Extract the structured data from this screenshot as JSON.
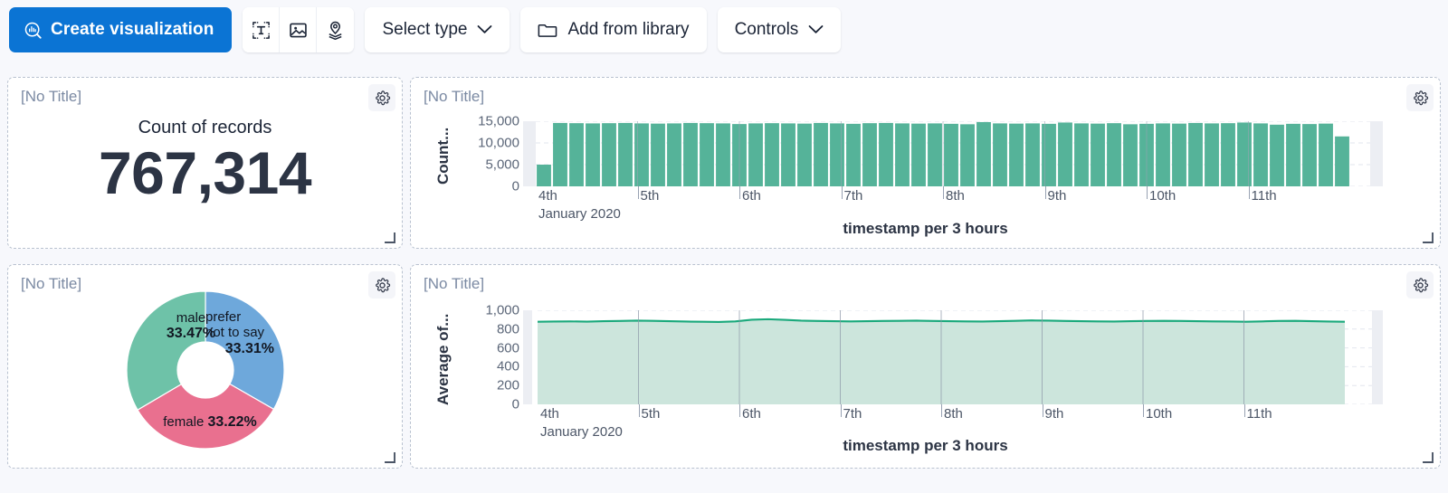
{
  "toolbar": {
    "create_button": "Create visualization",
    "create_icon": "lens-visualization-icon",
    "icon_buttons": [
      {
        "name": "text-icon",
        "label": "Text"
      },
      {
        "name": "image-icon",
        "label": "Image"
      },
      {
        "name": "map-layers-icon",
        "label": "Map"
      }
    ],
    "select_type": "Select type",
    "add_from_library": "Add from library",
    "add_from_library_icon": "folder-icon",
    "controls": "Controls",
    "chevron_icon": "chevron-down-icon",
    "primary_color": "#0b74d4"
  },
  "panels": [
    {
      "title": "[No Title]",
      "gear_icon": "gear-icon",
      "resize_icon": "resize-handle-icon"
    },
    {
      "title": "[No Title]",
      "gear_icon": "gear-icon",
      "resize_icon": "resize-handle-icon"
    },
    {
      "title": "[No Title]",
      "gear_icon": "gear-icon",
      "resize_icon": "resize-handle-icon"
    },
    {
      "title": "[No Title]",
      "gear_icon": "gear-icon",
      "resize_icon": "resize-handle-icon"
    }
  ],
  "metric": {
    "label": "Count of records",
    "value": "767,314"
  },
  "colors": {
    "bar_green": "#55b399",
    "area_line": "#1ba97c",
    "area_fill": "#cce5dc",
    "donut_green": "#6ec2a8",
    "donut_blue": "#6ea8db",
    "donut_pink": "#e9708f"
  },
  "chart_data": [
    {
      "type": "bar",
      "title": "",
      "xlabel": "timestamp per 3 hours",
      "ylabel": "Count...",
      "ylabel_full": "Count of records",
      "ylim": [
        0,
        15000
      ],
      "yticks": [
        0,
        5000,
        10000,
        15000
      ],
      "ytick_labels": [
        "0",
        "5,000",
        "10,000",
        "15,000"
      ],
      "xtick_labels": [
        "4th",
        "5th",
        "6th",
        "7th",
        "8th",
        "9th",
        "10th",
        "11th"
      ],
      "xtick_sublabel": "January 2020",
      "grid": true,
      "legend": "none",
      "series_color": "#55b399",
      "values": [
        5000,
        14600,
        14550,
        14500,
        14550,
        14600,
        14500,
        14450,
        14500,
        14600,
        14550,
        14500,
        14350,
        14500,
        14550,
        14500,
        14450,
        14600,
        14500,
        14400,
        14550,
        14600,
        14500,
        14450,
        14500,
        14400,
        14300,
        14800,
        14500,
        14450,
        14500,
        14400,
        14700,
        14500,
        14450,
        14550,
        14300,
        14400,
        14500,
        14450,
        14600,
        14500,
        14550,
        14700,
        14500,
        14200,
        14400,
        14350,
        14450,
        11500
      ]
    },
    {
      "type": "pie",
      "subtype": "donut",
      "title": "",
      "labels": [
        "male",
        "prefer not to say",
        "female"
      ],
      "values": [
        33.47,
        33.31,
        33.22
      ],
      "value_labels": [
        "33.47%",
        "33.31%",
        "33.22%"
      ],
      "colors": [
        "#6ec2a8",
        "#6ea8db",
        "#e9708f"
      ],
      "legend": "none"
    },
    {
      "type": "area",
      "title": "",
      "xlabel": "timestamp per 3 hours",
      "ylabel": "Average of...",
      "ylim": [
        0,
        1000
      ],
      "yticks": [
        0,
        200,
        400,
        600,
        800,
        1000
      ],
      "ytick_labels": [
        "0",
        "200",
        "400",
        "600",
        "800",
        "1,000"
      ],
      "xtick_labels": [
        "4th",
        "5th",
        "6th",
        "7th",
        "8th",
        "9th",
        "10th",
        "11th"
      ],
      "xtick_sublabel": "January 2020",
      "grid": true,
      "legend": "none",
      "line_color": "#1ba97c",
      "fill_color": "#cce5dc",
      "values": [
        878,
        880,
        882,
        879,
        884,
        886,
        890,
        888,
        884,
        880,
        878,
        876,
        882,
        900,
        905,
        898,
        890,
        886,
        884,
        882,
        884,
        886,
        888,
        890,
        886,
        884,
        882,
        880,
        884,
        888,
        892,
        890,
        886,
        884,
        882,
        880,
        884,
        886,
        888,
        886,
        884,
        882,
        880,
        878,
        882,
        886,
        888,
        884,
        880,
        878
      ]
    }
  ]
}
